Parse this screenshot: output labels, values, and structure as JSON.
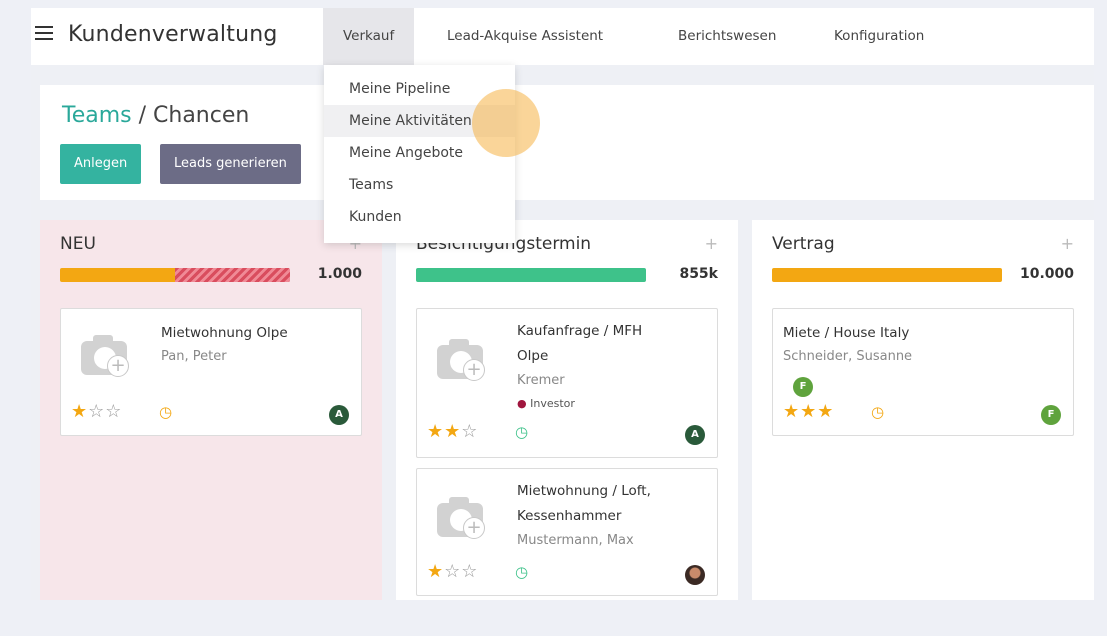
{
  "app": {
    "title": "Kundenverwaltung"
  },
  "menu": [
    {
      "label": "Verkauf",
      "active": true
    },
    {
      "label": "Lead-Akquise Assistent"
    },
    {
      "label": "Berichtswesen"
    },
    {
      "label": "Konfiguration"
    }
  ],
  "dropdown": [
    {
      "label": "Meine Pipeline"
    },
    {
      "label": "Meine Aktivitäten",
      "hover": true
    },
    {
      "label": "Meine Angebote"
    },
    {
      "label": "Teams"
    },
    {
      "label": "Kunden"
    }
  ],
  "breadcrumb": {
    "parent": "Teams",
    "separator": " / ",
    "current": "Chancen"
  },
  "buttons": {
    "create": "Anlegen",
    "generate_leads": "Leads generieren"
  },
  "colors": {
    "accent": "#34b3a0",
    "orange": "#f3a712",
    "green": "#3ec28a",
    "hatch": "#d94d5e"
  },
  "columns": {
    "neu": {
      "title": "NEU",
      "add": "+",
      "total": "1.000",
      "progress": [
        {
          "color": "#f3a712",
          "fraction": 0.5
        },
        {
          "color": "hatched",
          "fraction": 0.5
        }
      ],
      "cards": [
        {
          "title": "Mietwohnung Olpe",
          "customer": "Pan, Peter",
          "stars": 1,
          "avatar": "A",
          "clock_icon": "clock-orange"
        }
      ]
    },
    "besichtigung": {
      "title": "Besichtigungstermin",
      "add": "+",
      "total": "855k",
      "progress": [
        {
          "color": "#3ec28a",
          "fraction": 1.0
        }
      ],
      "cards": [
        {
          "title_line1": "Kaufanfrage / MFH",
          "title_line2": "Olpe",
          "customer": "Kremer",
          "tag": "Investor",
          "stars": 2,
          "avatar": "A",
          "clock_icon": "clock-green"
        },
        {
          "title_line1": "Mietwohnung / Loft,",
          "title_line2": "Kessenhammer",
          "customer": "Mustermann, Max",
          "stars": 1,
          "avatar": "photo",
          "clock_icon": "clock-green"
        }
      ]
    },
    "vertrag": {
      "title": "Vertrag",
      "add": "+",
      "total": "10.000",
      "progress": [
        {
          "color": "#f3a712",
          "fraction": 1.0
        }
      ],
      "cards": [
        {
          "title": "Miete / House Italy",
          "customer": "Schneider, Susanne",
          "stars": 3,
          "avatar": "F",
          "badge": "F",
          "clock_icon": "clock-orange"
        }
      ]
    }
  }
}
